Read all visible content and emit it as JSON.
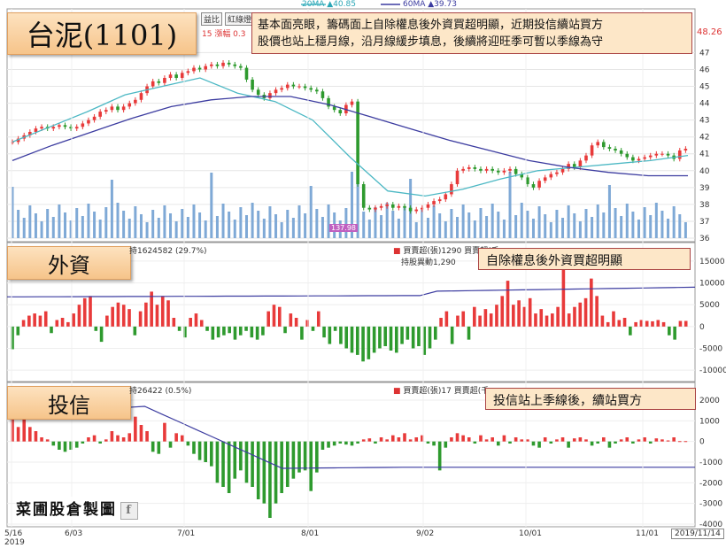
{
  "header": {
    "ma20_label": "20MA",
    "ma20_value": "▲40.85",
    "ma60_label": "60MA",
    "ma60_value": "▲39.73",
    "price_right": "48.26",
    "tab1": "益比",
    "tab2": "紅綠燈",
    "partial_left": "15 漲幅 0.3"
  },
  "title": {
    "text": "台泥(1101)"
  },
  "note_main": {
    "line1": "基本面亮眼，籌碼面上自除權息後外資買超明顯，近期投信續站買方",
    "line2": "股價也站上穩月線，沿月線緩步填息，後續將迎旺季可暫以季線為守"
  },
  "foreign": {
    "label": "外資",
    "info_left": "持1624582 (29.7%)",
    "legend": "買賣超(張)1290 買賣超(千",
    "legend2": "持股異動1,290",
    "note": "自除權息後外資買超明顯"
  },
  "trust": {
    "label": "投信",
    "info_left": "持26422 (0.5%)",
    "legend": "買賣超(張)17 買賣超(千",
    "note": "投信站上季線後，續站買方"
  },
  "watermark": {
    "text": "菜圃股倉製圖",
    "fb": "f"
  },
  "volume_marker": "137.98",
  "date_stamp": "2019/11/14",
  "colors": {
    "up": "#e83a3a",
    "down": "#2e9a2e",
    "ma20": "#4cb8c4",
    "ma60": "#3c3ca0",
    "volume": "#7fa9d6"
  },
  "chart_data": [
    {
      "type": "candlestick",
      "title": "台泥(1101)",
      "x": [
        "5/16",
        "6/03",
        "7/01",
        "8/01",
        "9/02",
        "10/01",
        "11/01"
      ],
      "ylim": [
        36,
        48
      ],
      "yticks": [
        36,
        37,
        38,
        39,
        40,
        41,
        42,
        43,
        44,
        45,
        46,
        47
      ],
      "close": [
        41.7,
        41.9,
        42.1,
        42.3,
        42.5,
        42.6,
        42.5,
        42.6,
        42.7,
        42.6,
        42.5,
        42.6,
        42.8,
        43.0,
        43.2,
        43.5,
        43.6,
        43.8,
        43.6,
        43.8,
        44.0,
        44.2,
        44.6,
        45.0,
        45.3,
        45.2,
        45.5,
        45.7,
        45.5,
        45.8,
        45.9,
        46.1,
        46.0,
        46.2,
        46.3,
        46.2,
        46.4,
        46.3,
        46.2,
        46.1,
        45.4,
        44.8,
        44.5,
        44.3,
        44.6,
        44.8,
        44.9,
        45.1,
        45.0,
        45.0,
        44.9,
        44.8,
        44.7,
        44.3,
        43.8,
        43.6,
        43.4,
        43.9,
        44.1,
        39.2,
        37.8,
        37.7,
        37.8,
        37.9,
        38.0,
        37.8,
        37.9,
        37.8,
        37.6,
        37.7,
        37.8,
        38.0,
        38.2,
        38.3,
        38.6,
        39.2,
        40.0,
        40.1,
        40.2,
        40.1,
        40.0,
        40.1,
        40.0,
        39.9,
        40.0,
        40.1,
        39.8,
        39.6,
        39.2,
        39.0,
        39.4,
        39.6,
        39.8,
        39.9,
        40.1,
        40.4,
        40.2,
        40.6,
        40.9,
        41.5,
        41.7,
        41.4,
        41.3,
        41.2,
        41.0,
        40.8,
        40.6,
        40.7,
        40.8,
        40.9,
        41.0,
        41.0,
        40.9,
        40.7,
        41.2,
        41.3
      ],
      "ma20_approx": [
        41.7,
        42.6,
        43.5,
        44.5,
        45.0,
        45.5,
        44.6,
        44.1,
        43.0,
        40.8,
        38.8,
        38.5,
        38.9,
        39.5,
        40.0,
        40.2,
        40.4,
        40.6,
        40.9
      ],
      "ma60_approx": [
        40.6,
        41.5,
        42.3,
        43.1,
        43.8,
        44.2,
        44.4,
        44.4,
        43.9,
        43.2,
        42.5,
        41.8,
        41.2,
        40.6,
        40.2,
        39.9,
        39.7,
        39.7
      ],
      "volume_note": "volume bars at bottom of price panel, marker 137.98 near 8/01"
    },
    {
      "type": "bar",
      "title": "外資",
      "series_name": "買賣超(張)",
      "ylim": [
        -12000,
        16000
      ],
      "yticks": [
        15000,
        10000,
        5000,
        0,
        -5000,
        -10000
      ],
      "values": [
        -5200,
        -2000,
        1500,
        2500,
        3000,
        2500,
        3500,
        -1500,
        1500,
        2000,
        1000,
        3000,
        5000,
        6500,
        7000,
        -1000,
        -3500,
        2500,
        4500,
        5500,
        5000,
        4000,
        -2000,
        3500,
        5500,
        8000,
        5000,
        7000,
        6000,
        2000,
        -1000,
        -2500,
        2000,
        3000,
        1500,
        -1000,
        -3000,
        -2500,
        -2000,
        -1500,
        -3000,
        -2000,
        -1000,
        -2500,
        -3000,
        -2000,
        3500,
        5000,
        4500,
        -1500,
        3000,
        2000,
        -3000,
        1500,
        -1000,
        3500,
        -2500,
        -4000,
        -1000,
        -4000,
        -5000,
        -6000,
        -6500,
        -8000,
        -7500,
        -6000,
        -5000,
        -4500,
        -5500,
        -6000,
        -4000,
        -3000,
        -5000,
        -4500,
        -6500,
        -5000,
        -3000,
        2000,
        3500,
        -4000,
        2500,
        3500,
        -3000,
        4500,
        2500,
        4000,
        3000,
        5000,
        7000,
        10500,
        5000,
        6000,
        4500,
        6500,
        3000,
        4000,
        2500,
        3000,
        4500,
        14000,
        3000,
        4500,
        5500,
        6500,
        11000,
        7000,
        2500,
        1000,
        3500,
        1500,
        2000,
        -2000,
        1000,
        1500,
        1290,
        1200,
        1500,
        1000,
        -2000,
        -3000,
        1290,
        1290
      ],
      "holding_line_note": "持股 line rising from ~6800 to ~9000 scale"
    },
    {
      "type": "bar",
      "title": "投信",
      "series_name": "買賣超(張)",
      "ylim": [
        -4000,
        2000
      ],
      "yticks": [
        2000,
        1000,
        0,
        -1000,
        -2000,
        -3000,
        -4000
      ],
      "values": [
        1100,
        700,
        1300,
        700,
        500,
        200,
        100,
        -200,
        -400,
        -500,
        -400,
        -300,
        -100,
        200,
        300,
        -100,
        100,
        500,
        300,
        200,
        400,
        1200,
        800,
        500,
        -500,
        -600,
        900,
        -300,
        400,
        300,
        -200,
        -600,
        -900,
        -1000,
        -1200,
        -2000,
        -2200,
        -2500,
        -1800,
        -1400,
        -2000,
        -2200,
        -2800,
        -3000,
        -3700,
        -3000,
        -2500,
        -2200,
        -1800,
        -1500,
        -1400,
        -2400,
        -1500,
        -400,
        -300,
        -200,
        -100,
        -150,
        -200,
        -100,
        100,
        150,
        -100,
        200,
        100,
        300,
        200,
        400,
        100,
        200,
        300,
        -100,
        -200,
        -1400,
        -300,
        200,
        400,
        300,
        200,
        -100,
        300,
        100,
        200,
        -200,
        300,
        -100,
        200,
        100,
        100,
        -200,
        -300,
        200,
        -100,
        100,
        200,
        -300,
        150,
        200,
        100,
        -200,
        -100,
        200,
        -300,
        -100,
        100,
        200,
        -100,
        100,
        200,
        -100,
        150,
        100,
        50,
        200,
        17,
        17
      ],
      "holding_line_note": "持股 line from ~1700 down to ~-1200"
    }
  ]
}
